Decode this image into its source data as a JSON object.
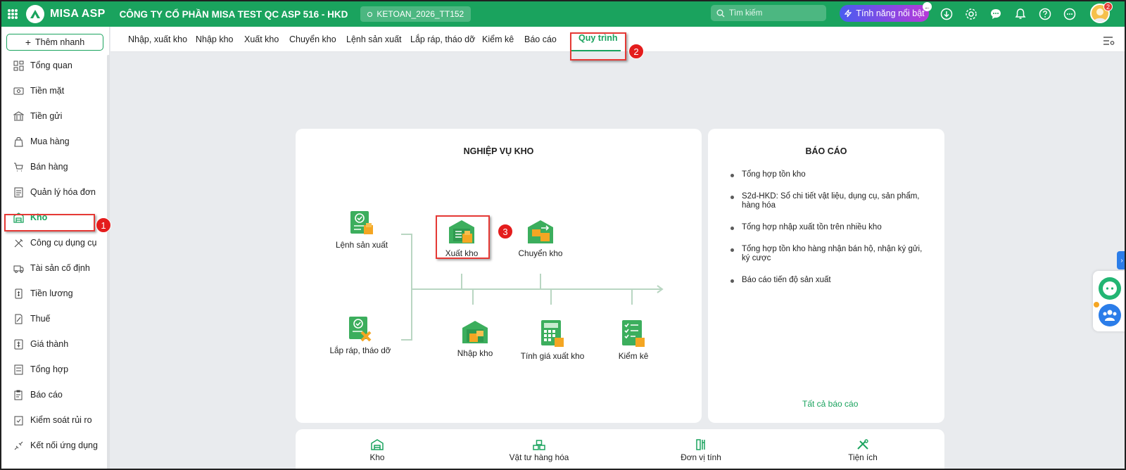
{
  "topbar": {
    "app_name": "MISA ASP",
    "company": "CÔNG TY CỔ PHẦN MISA TEST QC ASP 516 - HKD",
    "database": "KETOAN_2026_TT152",
    "search_placeholder": "Tìm kiếm",
    "feature_button": "Tính năng nổi bật",
    "notification_count": "2",
    "icons": [
      "download-icon",
      "settings-icon",
      "chat-icon",
      "bell-icon",
      "help-icon",
      "more-icon"
    ]
  },
  "sidebar": {
    "quick_add": "Thêm nhanh",
    "items": [
      {
        "label": "Tổng quan",
        "icon": "dashboard-icon"
      },
      {
        "label": "Tiền mặt",
        "icon": "cash-icon"
      },
      {
        "label": "Tiền gửi",
        "icon": "bank-icon"
      },
      {
        "label": "Mua hàng",
        "icon": "shopping-bag-icon"
      },
      {
        "label": "Bán hàng",
        "icon": "cart-icon"
      },
      {
        "label": "Quản lý hóa đơn",
        "icon": "invoice-icon"
      },
      {
        "label": "Kho",
        "icon": "warehouse-icon",
        "active": true
      },
      {
        "label": "Công cụ dụng cụ",
        "icon": "tools-icon"
      },
      {
        "label": "Tài sản cố định",
        "icon": "truck-icon"
      },
      {
        "label": "Tiền lương",
        "icon": "salary-icon"
      },
      {
        "label": "Thuế",
        "icon": "tax-icon"
      },
      {
        "label": "Giá thành",
        "icon": "cost-icon"
      },
      {
        "label": "Tổng hợp",
        "icon": "summary-icon"
      },
      {
        "label": "Báo cáo",
        "icon": "report-icon"
      },
      {
        "label": "Kiểm soát rủi ro",
        "icon": "risk-icon"
      },
      {
        "label": "Kết nối ứng dụng",
        "icon": "connect-icon"
      }
    ]
  },
  "tabs": [
    {
      "label": "Nhập, xuất kho"
    },
    {
      "label": "Nhập kho"
    },
    {
      "label": "Xuất kho"
    },
    {
      "label": "Chuyển kho"
    },
    {
      "label": "Lệnh sản xuất"
    },
    {
      "label": "Lắp ráp, tháo dỡ"
    },
    {
      "label": "Kiểm kê"
    },
    {
      "label": "Báo cáo"
    },
    {
      "label": "Quy trình",
      "active": true
    }
  ],
  "annotations": [
    "1",
    "2",
    "3"
  ],
  "process": {
    "title": "NGHIỆP VỤ KHO",
    "nodes": {
      "production_order": "Lệnh sản xuất",
      "assembly": "Lắp ráp, tháo dỡ",
      "stock_out": "Xuất kho",
      "transfer": "Chuyển kho",
      "stock_in": "Nhập kho",
      "costing": "Tính giá xuất kho",
      "stocktake": "Kiểm kê"
    }
  },
  "reports": {
    "title": "BÁO CÁO",
    "items": [
      "Tổng hợp tồn kho",
      "S2d-HKD: Sổ chi tiết vật liệu, dụng cụ, sản phẩm, hàng hóa",
      "Tổng hợp nhập xuất tồn trên nhiều kho",
      "Tổng hợp tồn kho hàng nhận bán hộ, nhận ký gửi, ký cược",
      "Báo cáo tiến độ sản xuất"
    ],
    "all_link": "Tất cả báo cáo"
  },
  "bottom_bar": [
    {
      "label": "Kho",
      "icon": "warehouse-icon"
    },
    {
      "label": "Vật tư hàng hóa",
      "icon": "goods-icon"
    },
    {
      "label": "Đơn vị tính",
      "icon": "unit-icon"
    },
    {
      "label": "Tiện ích",
      "icon": "utility-icon"
    }
  ],
  "colors": {
    "brand": "#1aa35e",
    "highlight": "#e53935",
    "background": "#e9ebee"
  }
}
